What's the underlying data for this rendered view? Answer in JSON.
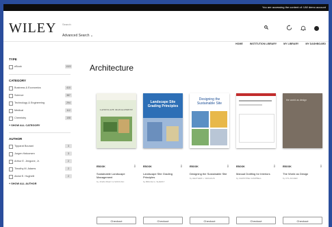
{
  "topbar": {
    "notice": "You are accessing the content of: UW demo account"
  },
  "header": {
    "logo": "WILEY",
    "search_placeholder": "Search",
    "advanced_search": "Advanced Search ⌄",
    "icons": [
      "search-icon",
      "history-icon",
      "bell-icon",
      "user-icon"
    ]
  },
  "nav": {
    "items": [
      "HOME",
      "INSTITUTION LIBRARY",
      "MY LIBRARY",
      "MY DASHBOARD"
    ]
  },
  "sidebar": {
    "type_title": "TYPE",
    "type_items": [
      {
        "label": "eBook",
        "count": "1322"
      }
    ],
    "category_title": "CATEGORY",
    "category_items": [
      {
        "label": "Business & Economics",
        "count": "410"
      },
      {
        "label": "Science",
        "count": "387"
      },
      {
        "label": "Technology & Engineering",
        "count": "294"
      },
      {
        "label": "Medical",
        "count": "112"
      },
      {
        "label": "Chemistry",
        "count": "108"
      }
    ],
    "show_all_category": "+ SHOW ALL CATEGORY",
    "author_title": "AUTHOR",
    "author_items": [
      {
        "label": "Tipparat Bourani",
        "count": "3"
      },
      {
        "label": "Jurgen Halvorsen",
        "count": "3"
      },
      {
        "label": "Arthur E. Jengone, Jr.",
        "count": "2"
      },
      {
        "label": "Timothy M. Adams",
        "count": "2"
      },
      {
        "label": "Abdul E. Hughelli",
        "count": "2"
      }
    ],
    "show_all_author": "+ SHOW ALL AUTHOR"
  },
  "main": {
    "title": "Architecture",
    "books": [
      {
        "type": "EBOOK",
        "title": "Sustainable Landscape Management",
        "author": "by JOHN WILEY & SONS INC",
        "cover": "landscape-management",
        "checkout": "Checkout"
      },
      {
        "type": "EBOOK",
        "title": "Landscape Site Grading Principles",
        "author": "by BRUCE G. SHARKY",
        "cover": "landscape-site-grading",
        "checkout": "Checkout"
      },
      {
        "type": "EBOOK",
        "title": "Designing the Sustainable Site",
        "author": "by HEATHER L. VENHAUS",
        "cover": "designing-sustainable-site",
        "checkout": "Checkout"
      },
      {
        "type": "EBOOK",
        "title": "Manual Drafting for Interiors",
        "author": "by CHRISTINE CAMPBELL",
        "cover": "manual-drafting",
        "checkout": "Checkout"
      },
      {
        "type": "EBOOK",
        "title": "The World as Design",
        "author": "by OTL AICHER",
        "cover": "world-as-design",
        "checkout": "Checkout"
      }
    ],
    "covers_text": {
      "b1": "LANDSCAPE MANAGEMENT",
      "b2_title": "Landscape Site Grading Principles",
      "b3_title": "Designing the Sustainable Site",
      "b5_title": "the world as design"
    }
  },
  "colors": {
    "background": "#2a4d9c",
    "topbar": "#0d0d0d",
    "cover1": "#dfe9d6",
    "cover2": "#2d6fb6",
    "cover3": "#5a8fc4",
    "cover5": "#7a6e62"
  }
}
